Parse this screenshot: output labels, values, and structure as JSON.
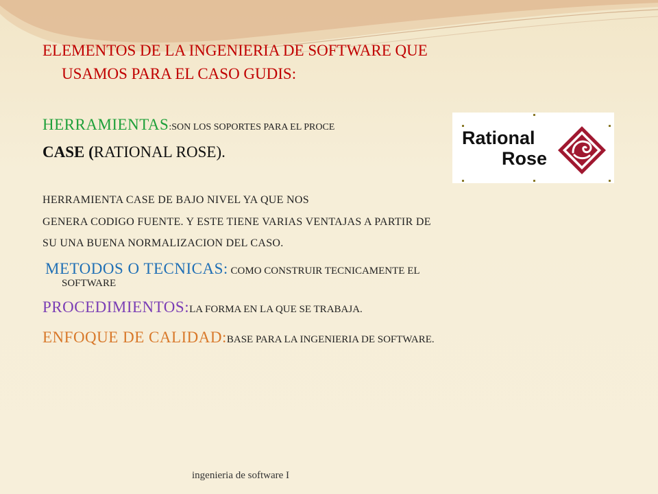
{
  "slide": {
    "title_line1": "ELEMENTOS DE LA INGENIERIA DE SOFTWARE QUE",
    "title_line2": "USAMOS PARA EL CASO GUDIS:",
    "herramientas": {
      "label": "HERRAMIENTAS",
      "text": ":SON LOS SOPORTES PARA EL PROCE"
    },
    "case_line": {
      "bold": "CASE (",
      "rest": "RATIONAL ROSE)."
    },
    "paragraph": [
      "HERRAMIENTA CASE DE BAJO NIVEL  YA QUE NOS",
      "GENERA CODIGO FUENTE. Y ESTE TIENE VARIAS VENTAJAS A PARTIR DE",
      "SU UNA BUENA NORMALIZACION DEL CASO."
    ],
    "metodos": {
      "label": "METODOS O TECNICAS:",
      "text": " COMO CONSTRUIR TECNICAMENTE EL",
      "text_line2": "SOFTWARE"
    },
    "procedimientos": {
      "label": "PROCEDIMIENTOS:",
      "text": "LA FORMA  EN LA QUE SE TRABAJA."
    },
    "enfoque": {
      "label": "ENFOQUE DE CALIDAD:",
      "text": "BASE PARA LA INGENIERIA DE SOFTWARE."
    },
    "footer": "ingenieria de software I"
  },
  "logo": {
    "word1": "Rational",
    "word2": "Rose",
    "icon": "rational-rose-diamond-icon"
  },
  "colors": {
    "background": "#f6eed8",
    "title": "#c00000",
    "herramientas": "#1fa03a",
    "metodos": "#1f6fb5",
    "procedimientos": "#7a3db5",
    "enfoque": "#d8782a",
    "logo_accent": "#a01830"
  }
}
